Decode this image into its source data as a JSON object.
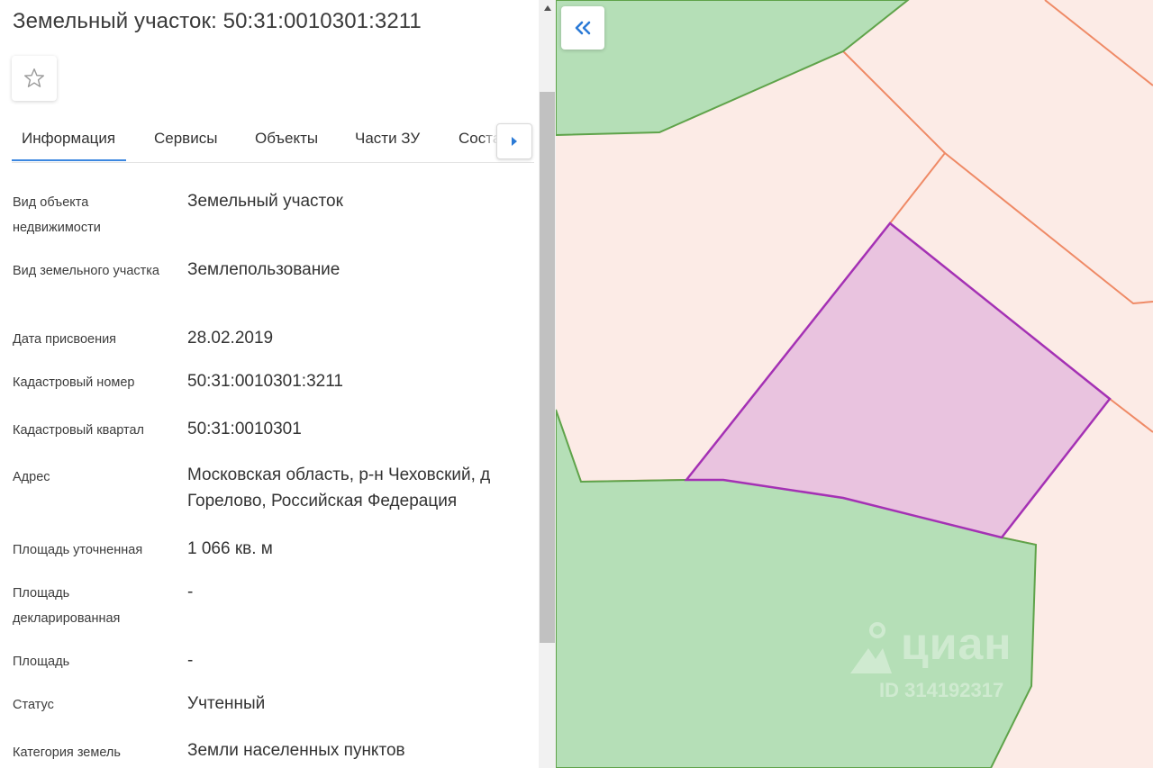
{
  "panel": {
    "title": "Земельный участок: 50:31:0010301:3211",
    "tabs": [
      {
        "label": "Информация"
      },
      {
        "label": "Сервисы"
      },
      {
        "label": "Объекты"
      },
      {
        "label": "Части ЗУ"
      },
      {
        "label": "Состав ЗУ"
      }
    ],
    "active_tab": "Информация",
    "rows": [
      {
        "label": "Вид объекта недвижимости",
        "value": "Земельный участок"
      },
      {
        "label": "Вид земельного участка",
        "value": "Землепользование"
      },
      {
        "label": "Дата присвоения",
        "value": "28.02.2019"
      },
      {
        "label": "Кадастровый номер",
        "value": "50:31:0010301:3211"
      },
      {
        "label": "Кадастровый квартал",
        "value": "50:31:0010301"
      },
      {
        "label": "Адрес",
        "value": "Московская область, р-н Чеховский, д Горелово, Российская Федерация"
      },
      {
        "label": "Площадь уточненная",
        "value": "1 066 кв. м"
      },
      {
        "label": "Площадь декларированная",
        "value": "-"
      },
      {
        "label": "Площадь",
        "value": "-"
      },
      {
        "label": "Статус",
        "value": "Учтенный"
      },
      {
        "label": "Категория земель",
        "value": "Земли населенных пунктов"
      }
    ]
  },
  "map": {
    "watermark_brand": "циан",
    "watermark_id": "ID 314192317",
    "colors": {
      "background": "#fcebe6",
      "green_fill": "#b5dfb7",
      "green_stroke": "#5fa34a",
      "selected_fill": "#e9c3df",
      "selected_stroke": "#a431b4",
      "parcel_stroke": "#ef8a66"
    }
  },
  "icons": {
    "favorite": "star-outline-icon",
    "tabs_next": "triangle-right-icon",
    "collapse": "double-chevron-left-icon",
    "scroll_up": "triangle-up-icon"
  }
}
